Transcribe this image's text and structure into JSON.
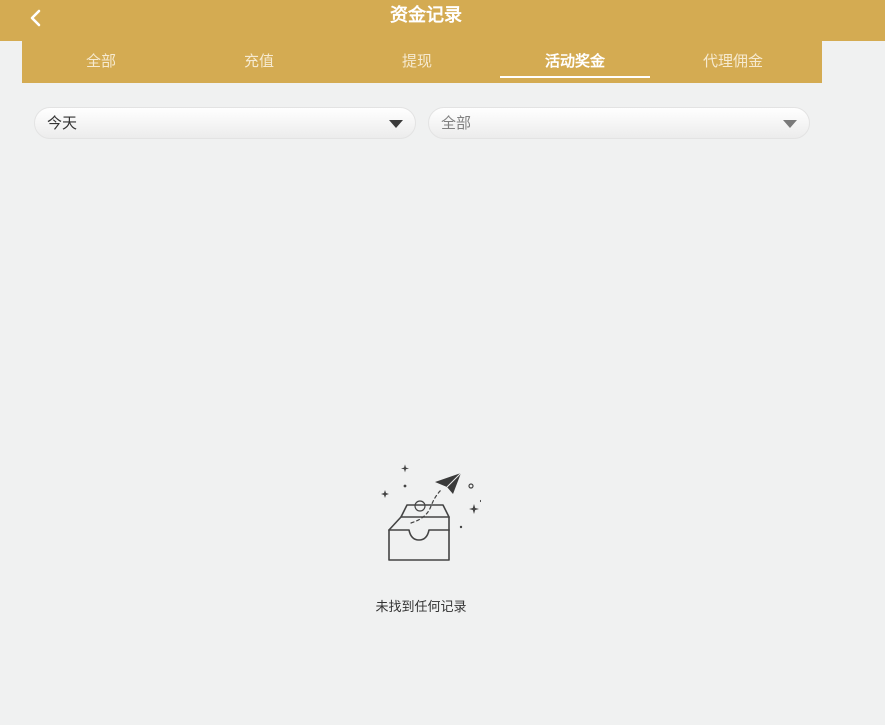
{
  "header": {
    "title": "资金记录",
    "back_icon": "chevron-left-icon",
    "background": "#d4ab52"
  },
  "tabs": [
    {
      "label": "全部",
      "active": false
    },
    {
      "label": "充值",
      "active": false
    },
    {
      "label": "提现",
      "active": false
    },
    {
      "label": "活动奖金",
      "active": true
    },
    {
      "label": "代理佣金",
      "active": false
    }
  ],
  "filters": {
    "date": {
      "selected": "今天"
    },
    "type": {
      "selected": "全部"
    }
  },
  "empty_state": {
    "icon": "empty-inbox-paper-plane-icon",
    "message": "未找到任何记录"
  }
}
